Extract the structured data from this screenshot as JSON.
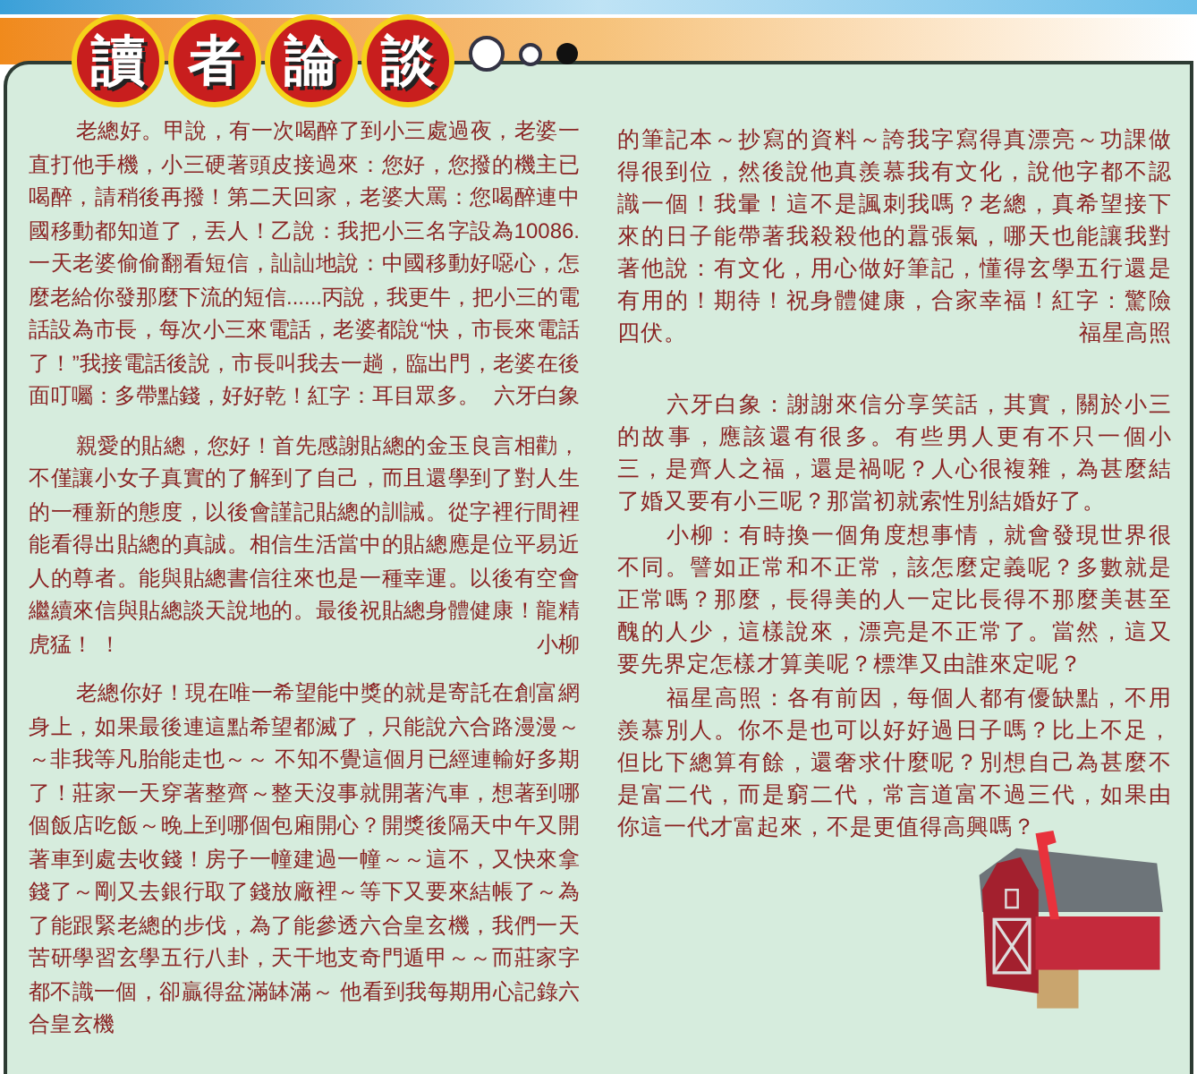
{
  "title": {
    "characters": [
      "讀",
      "者",
      "論",
      "談"
    ]
  },
  "left_column": [
    {
      "kind": "letter",
      "text": "老總好。甲說，有一次喝醉了到小三處過夜，老婆一直打他手機，小三硬著頭皮接過來：您好，您撥的機主已喝醉，請稍後再撥！第二天回家，老婆大罵：您喝醉連中國移動都知道了，丟人！乙說：我把小三名字設為10086.一天老婆偷偷翻看短信，訕訕地說：中國移動好噁心，怎麼老給你發那麼下流的短信......丙說，我更牛，把小三的電話設為市長，每次小三來電話，老婆都說“快，市長來電話了！”我接電話後說，市長叫我去一趟，臨出門，老婆在後面叮囑：多帶點錢，好好乾！紅字：耳目眾多。",
      "signature": "六牙白象"
    },
    {
      "kind": "letter",
      "text": "親愛的貼總，您好！首先感謝貼總的金玉良言相勸，不僅讓小女子真實的了解到了自己，而且還學到了對人生的一種新的態度，以後會謹記貼總的訓誡。從字裡行間裡能看得出貼總的真誠。相信生活當中的貼總應是位平易近人的尊者。能與貼總書信往來也是一種幸運。以後有空會繼續來信與貼總談天說地的。最後祝貼總身體健康！龍精虎猛！ ！",
      "signature": "小柳"
    },
    {
      "kind": "letter",
      "text": "老總你好！現在唯一希望能中獎的就是寄託在創富網身上，如果最後連這點希望都滅了，只能說六合路漫漫～～非我等凡胎能走也～～ 不知不覺這個月已經連輸好多期了！莊家一天穿著整齊～整天沒事就開著汽車，想著到哪個飯店吃飯～晚上到哪個包廂開心？開獎後隔天中午又開著車到處去收錢！房子一幢建過一幢～～這不，又快來拿錢了～剛又去銀行取了錢放廠裡～等下又要來結帳了～為了能跟緊老總的步伐，為了能參透六合皇玄機，我們一天苦研學習玄學五行八卦，天干地支奇門遁甲～～而莊家字都不識一個，卻贏得盆滿缽滿～ 他看到我每期用心記錄六合皇玄機"
    }
  ],
  "right_column": [
    {
      "kind": "continued",
      "text": "的筆記本～抄寫的資料～誇我字寫得真漂亮～功課做得很到位，然後說他真羨慕我有文化，說他字都不認識一個！我暈！這不是諷刺我嗎？老總，真希望接下來的日子能帶著我殺殺他的囂張氣，哪天也能讓我對著他說：有文化，用心做好筆記，懂得玄學五行還是有用的！期待！祝身體健康，合家幸福！紅字：驚險四伏。",
      "signature": "福星高照"
    },
    {
      "kind": "reply",
      "text": "六牙白象：謝謝來信分享笑話，其實，關於小三的故事，應該還有很多。有些男人更有不只一個小三，是齊人之福，還是禍呢？人心很複雜，為甚麼結了婚又要有小三呢？那當初就索性別結婚好了。"
    },
    {
      "kind": "reply",
      "text": "小柳：有時換一個角度想事情，就會發現世界很不同。譬如正常和不正常，該怎麼定義呢？多數就是正常嗎？那麼，長得美的人一定比長得不那麼美甚至醜的人少，這樣說來，漂亮是不正常了。當然，這又要先界定怎樣才算美呢？標準又由誰來定呢？"
    },
    {
      "kind": "reply",
      "text": "福星高照：各有前因，每個人都有優缺點，不用羨慕別人。你不是也可以好好過日子嗎？比上不足，但比下總算有餘，還奢求什麼呢？別想自己為甚麼不是富二代，而是窮二代，常言道富不過三代，如果由你這一代才富起來，不是更值得高興嗎？"
    }
  ]
}
